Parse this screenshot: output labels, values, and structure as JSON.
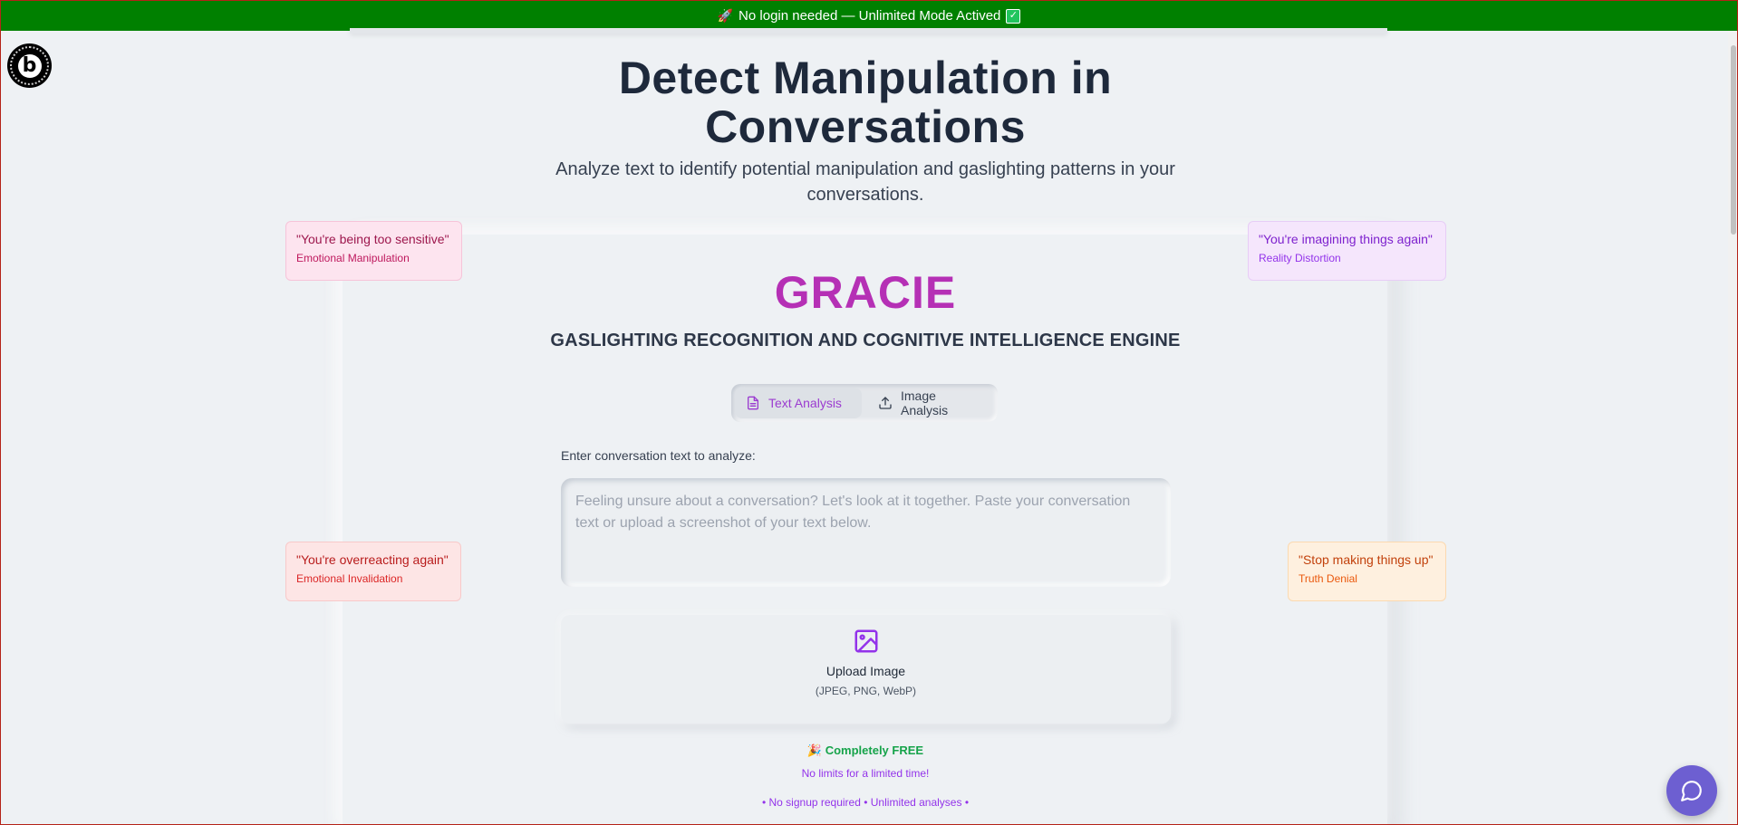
{
  "banner": {
    "rocket_emoji": "🚀",
    "text": "No login needed — Unlimited Mode Actived",
    "check": "✓"
  },
  "badge": {
    "letter": "b"
  },
  "hero": {
    "title": "Detect Manipulation in Conversations",
    "subtitle": "Analyze text to identify potential manipulation and gaslighting patterns in your conversations."
  },
  "quotes": [
    {
      "quote": "\"You're being too sensitive\"",
      "category": "Emotional Manipulation"
    },
    {
      "quote": "\"You're imagining things again\"",
      "category": "Reality Distortion"
    },
    {
      "quote": "\"You're overreacting again\"",
      "category": "Emotional Invalidation"
    },
    {
      "quote": "\"Stop making things up\"",
      "category": "Truth Denial"
    }
  ],
  "app": {
    "name": "GRACIE",
    "tagline": "GASLIGHTING RECOGNITION AND COGNITIVE INTELLIGENCE ENGINE",
    "tabs": [
      {
        "label": "Text Analysis",
        "icon": "document-icon",
        "active": true
      },
      {
        "label": "Image Analysis",
        "icon": "upload-icon",
        "active": false
      }
    ],
    "input_label": "Enter conversation text to analyze:",
    "textarea_placeholder": "Feeling unsure about a conversation? Let's look at it together. Paste your conversation text or upload a screenshot of your text below.",
    "textarea_value": "",
    "upload": {
      "icon": "image-icon",
      "label": "Upload Image",
      "formats": "(JPEG, PNG, WebP)"
    },
    "free": {
      "emoji": "🎉",
      "label": "Completely FREE",
      "limits": "No limits for a limited time!",
      "details": "• No signup required • Unlimited analyses •"
    }
  },
  "colors": {
    "banner": "#008000",
    "accent": "#b530b5",
    "tab_active": "#9b3bd0",
    "chat_button": "#6d5fd1"
  }
}
